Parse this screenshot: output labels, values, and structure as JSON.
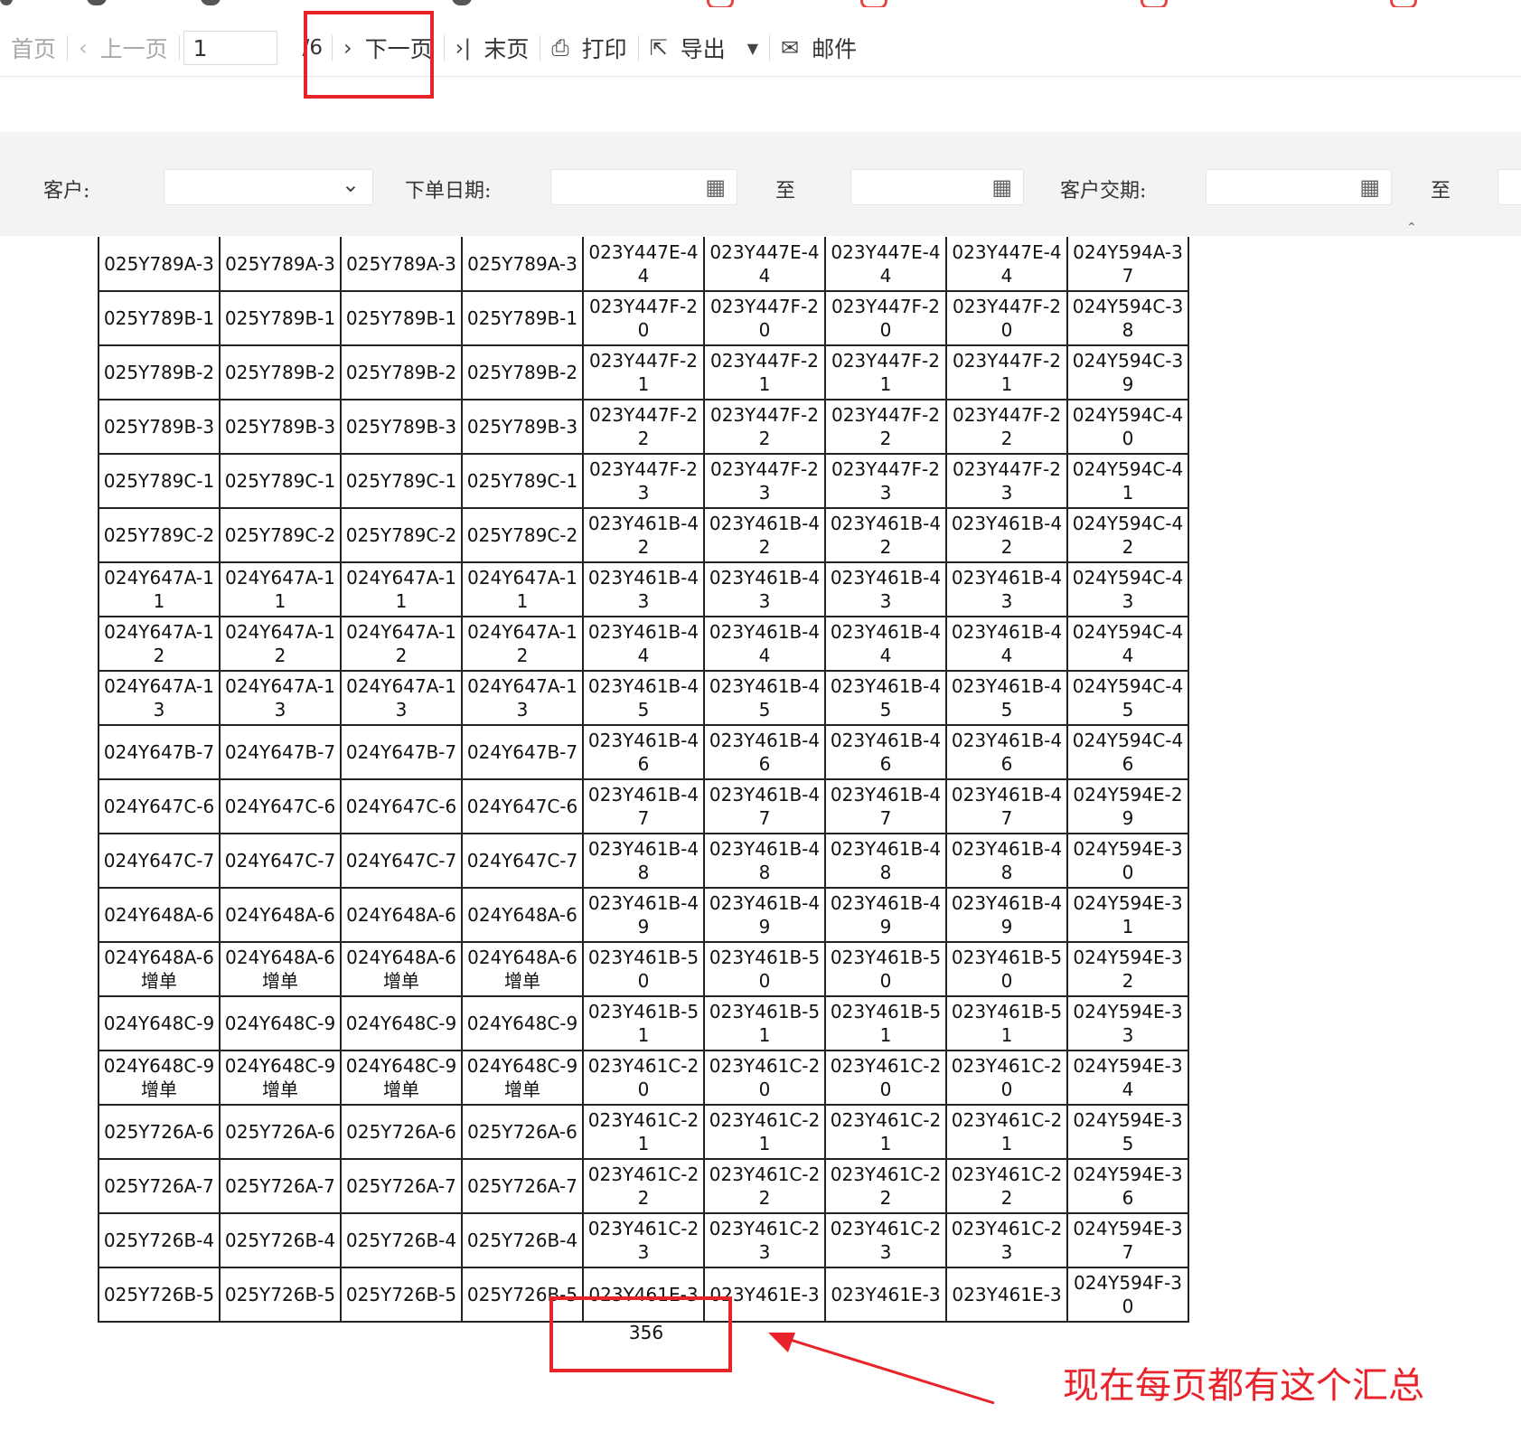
{
  "toolbar": {
    "first_label": "首页",
    "prev_label": "上一页",
    "page_value": "1",
    "total_pages": "/6",
    "next_label": "下一页",
    "last_label": "末页",
    "print_label": "打印",
    "export_label": "导出",
    "mail_label": "邮件"
  },
  "filters": {
    "customer_label": "客户:",
    "order_date_label": "下单日期:",
    "to_label": "至",
    "delivery_label": "客户交期:",
    "to_label_2": "至"
  },
  "table": {
    "rows": [
      [
        "025Y789A-3",
        "025Y789A-3",
        "025Y789A-3",
        "025Y789A-3",
        "023Y447E-44",
        "023Y447E-44",
        "023Y447E-44",
        "023Y447E-44",
        "024Y594A-37"
      ],
      [
        "025Y789B-1",
        "025Y789B-1",
        "025Y789B-1",
        "025Y789B-1",
        "023Y447F-20",
        "023Y447F-20",
        "023Y447F-20",
        "023Y447F-20",
        "024Y594C-38"
      ],
      [
        "025Y789B-2",
        "025Y789B-2",
        "025Y789B-2",
        "025Y789B-2",
        "023Y447F-21",
        "023Y447F-21",
        "023Y447F-21",
        "023Y447F-21",
        "024Y594C-39"
      ],
      [
        "025Y789B-3",
        "025Y789B-3",
        "025Y789B-3",
        "025Y789B-3",
        "023Y447F-22",
        "023Y447F-22",
        "023Y447F-22",
        "023Y447F-22",
        "024Y594C-40"
      ],
      [
        "025Y789C-1",
        "025Y789C-1",
        "025Y789C-1",
        "025Y789C-1",
        "023Y447F-23",
        "023Y447F-23",
        "023Y447F-23",
        "023Y447F-23",
        "024Y594C-41"
      ],
      [
        "025Y789C-2",
        "025Y789C-2",
        "025Y789C-2",
        "025Y789C-2",
        "023Y461B-42",
        "023Y461B-42",
        "023Y461B-42",
        "023Y461B-42",
        "024Y594C-42"
      ],
      [
        "024Y647A-11",
        "024Y647A-11",
        "024Y647A-11",
        "024Y647A-11",
        "023Y461B-43",
        "023Y461B-43",
        "023Y461B-43",
        "023Y461B-43",
        "024Y594C-43"
      ],
      [
        "024Y647A-12",
        "024Y647A-12",
        "024Y647A-12",
        "024Y647A-12",
        "023Y461B-44",
        "023Y461B-44",
        "023Y461B-44",
        "023Y461B-44",
        "024Y594C-44"
      ],
      [
        "024Y647A-13",
        "024Y647A-13",
        "024Y647A-13",
        "024Y647A-13",
        "023Y461B-45",
        "023Y461B-45",
        "023Y461B-45",
        "023Y461B-45",
        "024Y594C-45"
      ],
      [
        "024Y647B-7",
        "024Y647B-7",
        "024Y647B-7",
        "024Y647B-7",
        "023Y461B-46",
        "023Y461B-46",
        "023Y461B-46",
        "023Y461B-46",
        "024Y594C-46"
      ],
      [
        "024Y647C-6",
        "024Y647C-6",
        "024Y647C-6",
        "024Y647C-6",
        "023Y461B-47",
        "023Y461B-47",
        "023Y461B-47",
        "023Y461B-47",
        "024Y594E-29"
      ],
      [
        "024Y647C-7",
        "024Y647C-7",
        "024Y647C-7",
        "024Y647C-7",
        "023Y461B-48",
        "023Y461B-48",
        "023Y461B-48",
        "023Y461B-48",
        "024Y594E-30"
      ],
      [
        "024Y648A-6",
        "024Y648A-6",
        "024Y648A-6",
        "024Y648A-6",
        "023Y461B-49",
        "023Y461B-49",
        "023Y461B-49",
        "023Y461B-49",
        "024Y594E-31"
      ],
      [
        "024Y648A-6增单",
        "024Y648A-6增单",
        "024Y648A-6增单",
        "024Y648A-6增单",
        "023Y461B-50",
        "023Y461B-50",
        "023Y461B-50",
        "023Y461B-50",
        "024Y594E-32"
      ],
      [
        "024Y648C-9",
        "024Y648C-9",
        "024Y648C-9",
        "024Y648C-9",
        "023Y461B-51",
        "023Y461B-51",
        "023Y461B-51",
        "023Y461B-51",
        "024Y594E-33"
      ],
      [
        "024Y648C-9增单",
        "024Y648C-9增单",
        "024Y648C-9增单",
        "024Y648C-9增单",
        "023Y461C-20",
        "023Y461C-20",
        "023Y461C-20",
        "023Y461C-20",
        "024Y594E-34"
      ],
      [
        "025Y726A-6",
        "025Y726A-6",
        "025Y726A-6",
        "025Y726A-6",
        "023Y461C-21",
        "023Y461C-21",
        "023Y461C-21",
        "023Y461C-21",
        "024Y594E-35"
      ],
      [
        "025Y726A-7",
        "025Y726A-7",
        "025Y726A-7",
        "025Y726A-7",
        "023Y461C-22",
        "023Y461C-22",
        "023Y461C-22",
        "023Y461C-22",
        "024Y594E-36"
      ],
      [
        "025Y726B-4",
        "025Y726B-4",
        "025Y726B-4",
        "025Y726B-4",
        "023Y461C-23",
        "023Y461C-23",
        "023Y461C-23",
        "023Y461C-23",
        "024Y594E-37"
      ],
      [
        "025Y726B-5",
        "025Y726B-5",
        "025Y726B-5",
        "025Y726B-5",
        "023Y461E-3",
        "023Y461E-3",
        "023Y461E-3",
        "023Y461E-3",
        "024Y594F-30"
      ]
    ]
  },
  "summary": {
    "total": "356"
  },
  "annotation": {
    "text": "现在每页都有这个汇总",
    "color": "#e8232a"
  },
  "icons": {
    "first": "double-chevron-left-icon",
    "prev": "chevron-left-icon",
    "next": "chevron-right-icon",
    "last": "last-page-icon",
    "print": "printer-icon",
    "export": "export-icon",
    "mail": "mail-icon",
    "calendar": "calendar-icon"
  }
}
